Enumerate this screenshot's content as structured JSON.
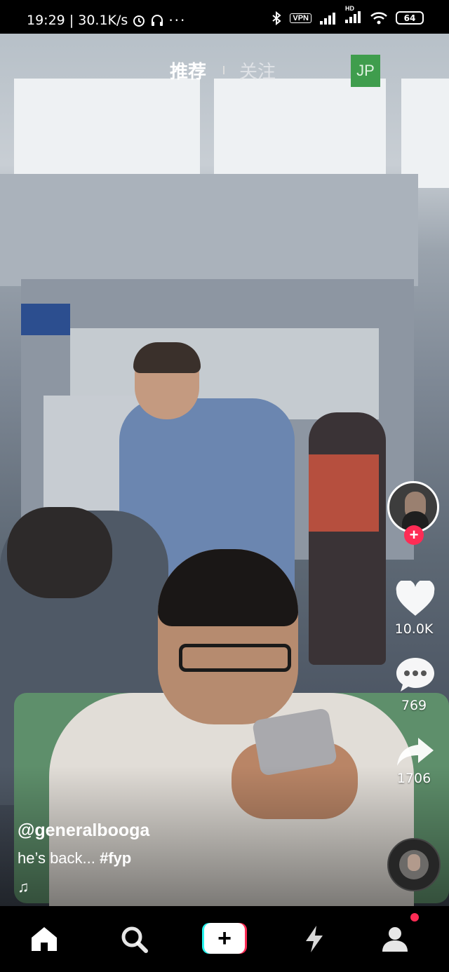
{
  "status_bar": {
    "time_speed": "19:29 | 30.1K/s",
    "vpn": "VPN",
    "network": "HD",
    "battery": "64"
  },
  "top_nav": {
    "recommended": "推荐",
    "following": "关注",
    "jp_badge": "JP"
  },
  "actions": {
    "likes": "10.0K",
    "comments": "769",
    "shares": "1706",
    "follow_symbol": "+"
  },
  "caption": {
    "username": "@generalbooga",
    "text": "he’s back... ",
    "hashtag": "#fyp",
    "music_symbol": "♫"
  },
  "bottom_nav": {
    "items": [
      "home-icon",
      "search-icon",
      "create-icon",
      "inbox-icon",
      "profile-icon"
    ],
    "create_symbol": "+"
  },
  "colors": {
    "accent_red": "#fe2c55",
    "accent_cyan": "#25f4ee",
    "jp_green": "#3f9d4d"
  }
}
